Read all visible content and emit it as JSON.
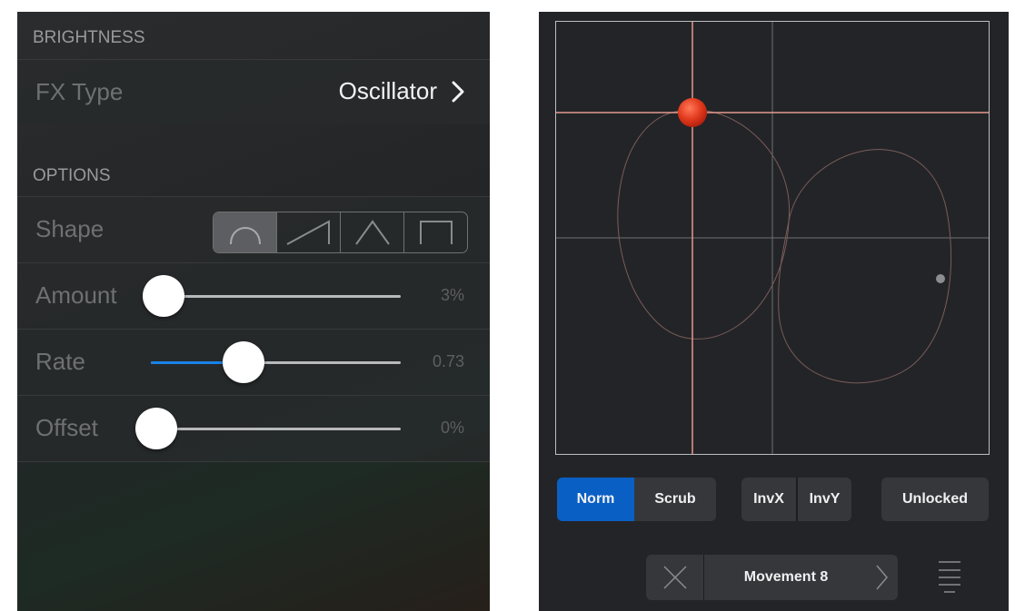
{
  "left": {
    "brightness_header": "BRIGHTNESS",
    "fx_type": {
      "label": "FX Type",
      "value": "Oscillator"
    },
    "options_header": "OPTIONS",
    "shape": {
      "label": "Shape",
      "options": [
        "arch",
        "ramp",
        "triangle",
        "square"
      ],
      "selected": "arch"
    },
    "sliders": {
      "amount": {
        "label": "Amount",
        "value_text": "3%",
        "fraction": 0.03
      },
      "rate": {
        "label": "Rate",
        "value_text": "0.73",
        "fraction": 0.35
      },
      "offset": {
        "label": "Offset",
        "value_text": "0%",
        "fraction": 0.0
      }
    },
    "accent_color": "#1a82e8"
  },
  "right": {
    "pad": {
      "cursor_color": "#e23a1d",
      "crosshair_color": "#e39a8e"
    },
    "mode_buttons": {
      "norm": "Norm",
      "scrub": "Scrub"
    },
    "invert_buttons": {
      "invx": "InvX",
      "invy": "InvY"
    },
    "lock_button": "Unlocked",
    "movement": {
      "name": "Movement 8"
    },
    "icons": {
      "clear": "close-icon",
      "next": "chevron-right-icon",
      "menu": "menu-icon"
    },
    "active_color": "#0a5fc4"
  }
}
